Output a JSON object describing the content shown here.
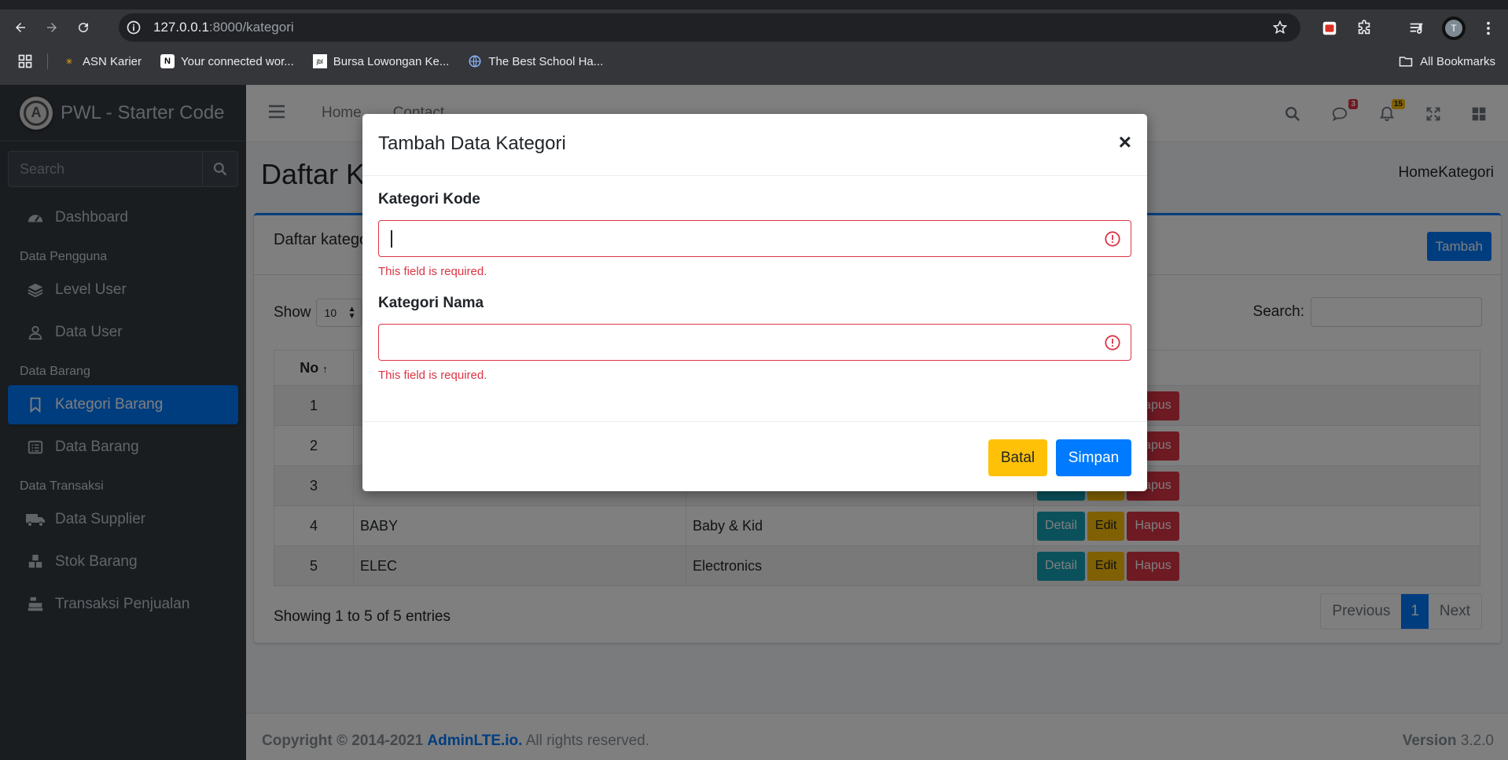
{
  "browser": {
    "url_host": "127.0.0.1",
    "url_rest": ":8000/kategori",
    "profile_initial": "T",
    "bookmarks": [
      "ASN Karier",
      "Your connected wor...",
      "Bursa Lowongan Ke...",
      "The Best School Ha..."
    ],
    "all_bookmarks": "All Bookmarks"
  },
  "sidebar": {
    "brand": "PWL - Starter Code",
    "search_placeholder": "Search",
    "dashboard": "Dashboard",
    "header_pengguna": "Data Pengguna",
    "level_user": "Level User",
    "data_user": "Data User",
    "header_barang": "Data Barang",
    "kategori_barang": "Kategori Barang",
    "data_barang": "Data Barang",
    "header_transaksi": "Data Transaksi",
    "data_supplier": "Data Supplier",
    "stok_barang": "Stok Barang",
    "transaksi_penjualan": "Transaksi Penjualan"
  },
  "topnav": {
    "home": "Home",
    "contact": "Contact",
    "messages_count": "3",
    "notifications_count": "15"
  },
  "page": {
    "title": "Daftar Kategori",
    "breadcrumb": "HomeKategori",
    "card_title": "Daftar kategori",
    "add_button": "Tambah",
    "show_label": "Show",
    "show_value": "10",
    "search_label": "Search:",
    "col_no": "No",
    "rows": [
      {
        "no": "1",
        "kode": "",
        "nama": ""
      },
      {
        "no": "2",
        "kode": "",
        "nama": ""
      },
      {
        "no": "3",
        "kode": "",
        "nama": ""
      },
      {
        "no": "4",
        "kode": "BABY",
        "nama": "Baby & Kid"
      },
      {
        "no": "5",
        "kode": "ELEC",
        "nama": "Electronics"
      }
    ],
    "btn_detail": "Detail",
    "btn_edit": "Edit",
    "btn_hapus": "Hapus",
    "info": "Showing 1 to 5 of 5 entries",
    "prev": "Previous",
    "page_num": "1",
    "next": "Next"
  },
  "footer": {
    "copyright": "Copyright © 2014-2021",
    "link": "AdminLTE.io.",
    "rights": "All rights reserved.",
    "version_label": "Version",
    "version": "3.2.0"
  },
  "modal": {
    "title": "Tambah Data Kategori",
    "close": "×",
    "field1_label": "Kategori Kode",
    "field1_error": "This field is required.",
    "field2_label": "Kategori Nama",
    "field2_error": "This field is required.",
    "cancel": "Batal",
    "save": "Simpan"
  }
}
